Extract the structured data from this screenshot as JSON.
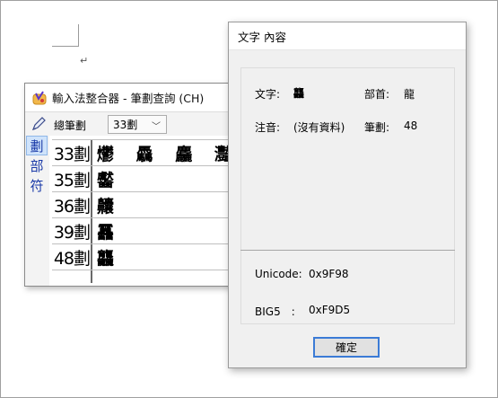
{
  "document": {
    "paragraph_mark": "↵"
  },
  "ime_window": {
    "title": "輸入法整合器 - 筆劃查詢 (CH)",
    "toolbar": {
      "stroke_label": "總筆劃",
      "stroke_select_value": "33劃"
    },
    "side_tabs": [
      {
        "label": "劃"
      },
      {
        "label": "部"
      },
      {
        "label": "符"
      }
    ],
    "rows": [
      {
        "label": "33劃",
        "chars": "爩 驫 麤 灩"
      },
      {
        "label": "35劃",
        "chars": "齾"
      },
      {
        "label": "36劃",
        "chars": "齉"
      },
      {
        "label": "39劃",
        "chars": "靐"
      },
      {
        "label": "48劃",
        "chars": "龘"
      }
    ]
  },
  "char_dialog": {
    "title": "文字 內容",
    "char_label": "文字:",
    "char_value": "龘",
    "radical_label": "部首:",
    "radical_value": "龍",
    "zhuyin_label": "注音:",
    "zhuyin_value": "(沒有資料)",
    "strokes_label": "筆劃:",
    "strokes_value": "48",
    "unicode_label": "Unicode:",
    "unicode_value": "0x9F98",
    "big5_label": "BIG5　:",
    "big5_value": "0xF9D5",
    "ok_label": "確定"
  }
}
